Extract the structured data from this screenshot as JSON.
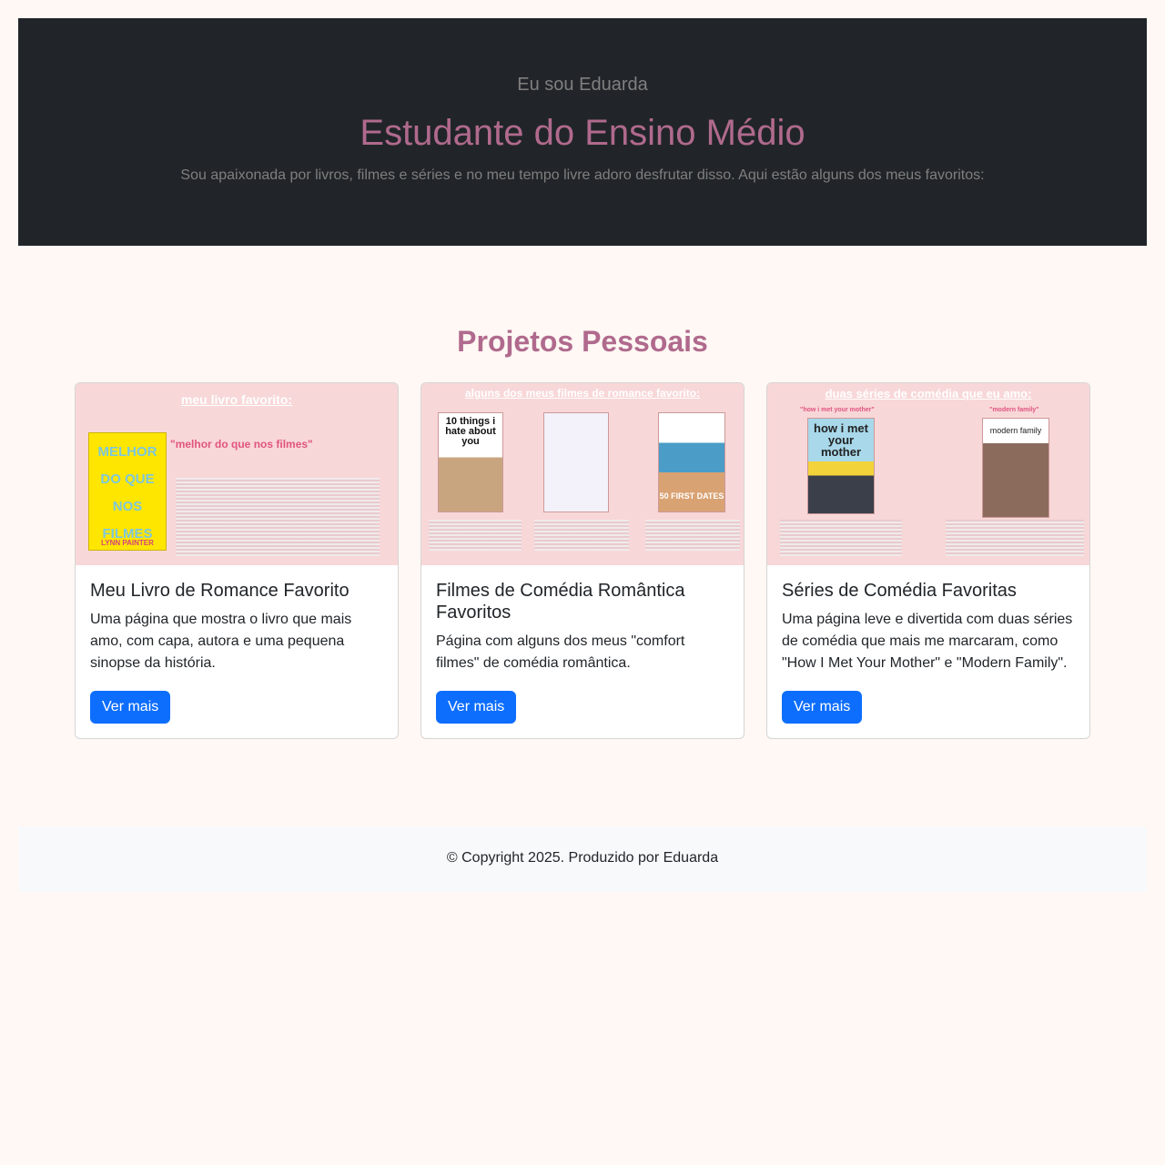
{
  "hero": {
    "intro": "Eu sou Eduarda",
    "role": "Estudante do Ensino Médio",
    "description": "Sou apaixonada por livros, filmes e séries e no meu tempo livre adoro desfrutar disso. Aqui estão alguns dos meus favoritos:"
  },
  "projects": {
    "title": "Projetos Pessoais",
    "cards": [
      {
        "image_heading": "meu livro favorito:",
        "image_quote": "\"melhor do que nos filmes\"",
        "poster_text": "MELHOR DO QUE NOS FILMES",
        "poster_author": "LYNN PAINTER",
        "title": "Meu Livro de Romance Favorito",
        "text": "Uma página que mostra o livro que mais amo, com capa, autora e uma pequena sinopse da história.",
        "button": "Ver mais"
      },
      {
        "image_heading": "alguns dos meus filmes de romance favorito:",
        "poster_1": "10 things i hate about you",
        "poster_3": "50 FIRST DATES",
        "title": "Filmes de Comédia Romântica Favoritos",
        "text": "Página com alguns dos meus \"comfort filmes\" de comédia romântica.",
        "button": "Ver mais"
      },
      {
        "image_heading": "duas séries de comédia que eu amo:",
        "quote_1": "\"how i met your mother\"",
        "quote_2": "\"modern family\"",
        "poster_1": "how i met your mother",
        "poster_2": "modern family",
        "title": "Séries de Comédia Favoritas",
        "text": "Uma página leve e divertida com duas séries de comédia que mais me marcaram, como \"How I Met Your Mother\" e \"Modern Family\".",
        "button": "Ver mais"
      }
    ]
  },
  "footer": {
    "copyright": "© Copyright 2025. Produzido por Eduarda"
  },
  "colors": {
    "accent": "#b06a8d",
    "hero_bg": "#212529",
    "button": "#0d6efd",
    "page_bg": "#fff8f4"
  }
}
